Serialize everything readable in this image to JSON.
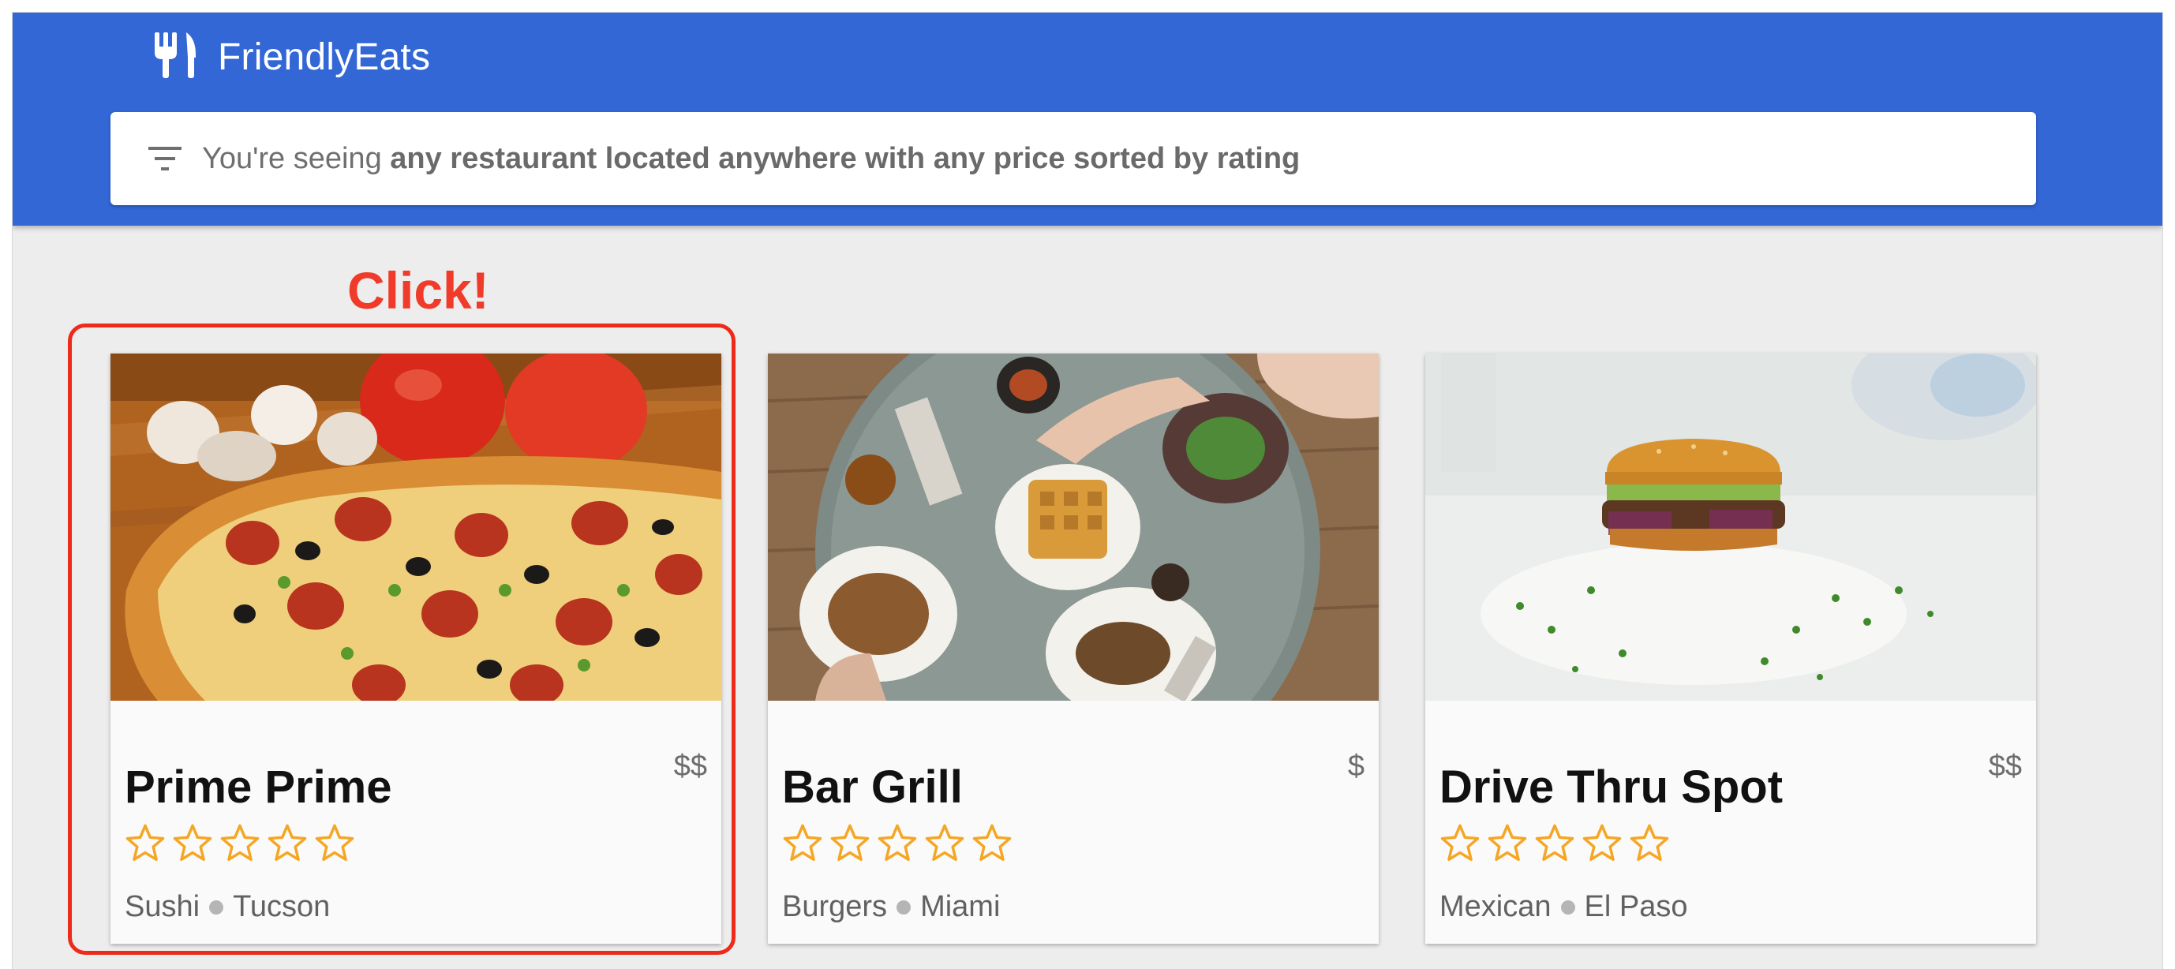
{
  "header": {
    "brand_name": "FriendlyEats",
    "brand_icon": "restaurant-icon",
    "background_color": "#3367d6"
  },
  "filter": {
    "icon": "filter-list-icon",
    "prefix": "You're seeing",
    "summary": "any restaurant located anywhere with any price sorted by rating"
  },
  "annotation": {
    "text": "Click!",
    "color": "#f03a2a",
    "target": "card-1"
  },
  "restaurants": [
    {
      "name": "Prime Prime",
      "price": "$$",
      "rating": 0,
      "max_rating": 5,
      "category": "Sushi",
      "city": "Tucson",
      "photo": "pizza"
    },
    {
      "name": "Bar Grill",
      "price": "$",
      "rating": 0,
      "max_rating": 5,
      "category": "Burgers",
      "city": "Miami",
      "photo": "brunch table"
    },
    {
      "name": "Drive Thru Spot",
      "price": "$$",
      "rating": 0,
      "max_rating": 5,
      "category": "Mexican",
      "city": "El Paso",
      "photo": "burger"
    }
  ],
  "colors": {
    "page_background": "#ededed",
    "card_background": "#fafafa",
    "star": "#f5a623"
  }
}
